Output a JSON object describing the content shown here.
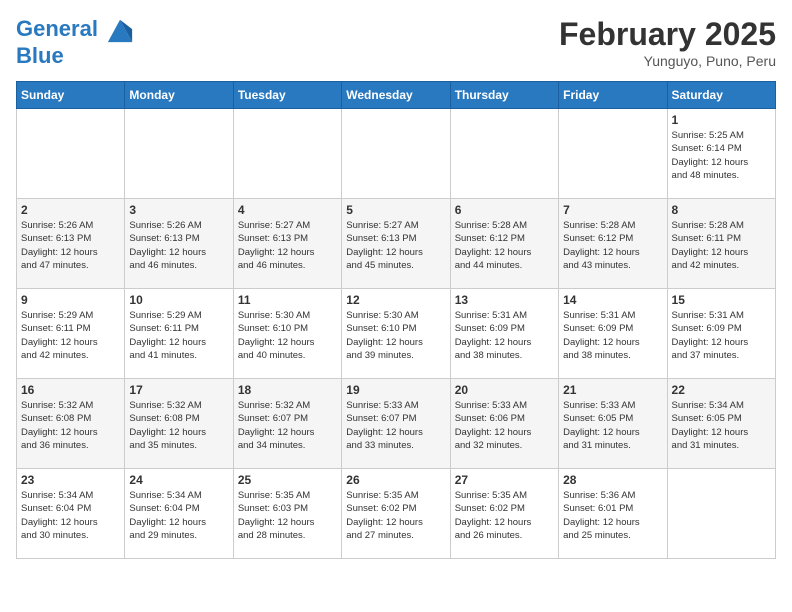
{
  "header": {
    "logo_line1": "General",
    "logo_line2": "Blue",
    "month_title": "February 2025",
    "subtitle": "Yunguyo, Puno, Peru"
  },
  "days_of_week": [
    "Sunday",
    "Monday",
    "Tuesday",
    "Wednesday",
    "Thursday",
    "Friday",
    "Saturday"
  ],
  "weeks": [
    [
      {
        "day": "",
        "info": ""
      },
      {
        "day": "",
        "info": ""
      },
      {
        "day": "",
        "info": ""
      },
      {
        "day": "",
        "info": ""
      },
      {
        "day": "",
        "info": ""
      },
      {
        "day": "",
        "info": ""
      },
      {
        "day": "1",
        "info": "Sunrise: 5:25 AM\nSunset: 6:14 PM\nDaylight: 12 hours\nand 48 minutes."
      }
    ],
    [
      {
        "day": "2",
        "info": "Sunrise: 5:26 AM\nSunset: 6:13 PM\nDaylight: 12 hours\nand 47 minutes."
      },
      {
        "day": "3",
        "info": "Sunrise: 5:26 AM\nSunset: 6:13 PM\nDaylight: 12 hours\nand 46 minutes."
      },
      {
        "day": "4",
        "info": "Sunrise: 5:27 AM\nSunset: 6:13 PM\nDaylight: 12 hours\nand 46 minutes."
      },
      {
        "day": "5",
        "info": "Sunrise: 5:27 AM\nSunset: 6:13 PM\nDaylight: 12 hours\nand 45 minutes."
      },
      {
        "day": "6",
        "info": "Sunrise: 5:28 AM\nSunset: 6:12 PM\nDaylight: 12 hours\nand 44 minutes."
      },
      {
        "day": "7",
        "info": "Sunrise: 5:28 AM\nSunset: 6:12 PM\nDaylight: 12 hours\nand 43 minutes."
      },
      {
        "day": "8",
        "info": "Sunrise: 5:28 AM\nSunset: 6:11 PM\nDaylight: 12 hours\nand 42 minutes."
      }
    ],
    [
      {
        "day": "9",
        "info": "Sunrise: 5:29 AM\nSunset: 6:11 PM\nDaylight: 12 hours\nand 42 minutes."
      },
      {
        "day": "10",
        "info": "Sunrise: 5:29 AM\nSunset: 6:11 PM\nDaylight: 12 hours\nand 41 minutes."
      },
      {
        "day": "11",
        "info": "Sunrise: 5:30 AM\nSunset: 6:10 PM\nDaylight: 12 hours\nand 40 minutes."
      },
      {
        "day": "12",
        "info": "Sunrise: 5:30 AM\nSunset: 6:10 PM\nDaylight: 12 hours\nand 39 minutes."
      },
      {
        "day": "13",
        "info": "Sunrise: 5:31 AM\nSunset: 6:09 PM\nDaylight: 12 hours\nand 38 minutes."
      },
      {
        "day": "14",
        "info": "Sunrise: 5:31 AM\nSunset: 6:09 PM\nDaylight: 12 hours\nand 38 minutes."
      },
      {
        "day": "15",
        "info": "Sunrise: 5:31 AM\nSunset: 6:09 PM\nDaylight: 12 hours\nand 37 minutes."
      }
    ],
    [
      {
        "day": "16",
        "info": "Sunrise: 5:32 AM\nSunset: 6:08 PM\nDaylight: 12 hours\nand 36 minutes."
      },
      {
        "day": "17",
        "info": "Sunrise: 5:32 AM\nSunset: 6:08 PM\nDaylight: 12 hours\nand 35 minutes."
      },
      {
        "day": "18",
        "info": "Sunrise: 5:32 AM\nSunset: 6:07 PM\nDaylight: 12 hours\nand 34 minutes."
      },
      {
        "day": "19",
        "info": "Sunrise: 5:33 AM\nSunset: 6:07 PM\nDaylight: 12 hours\nand 33 minutes."
      },
      {
        "day": "20",
        "info": "Sunrise: 5:33 AM\nSunset: 6:06 PM\nDaylight: 12 hours\nand 32 minutes."
      },
      {
        "day": "21",
        "info": "Sunrise: 5:33 AM\nSunset: 6:05 PM\nDaylight: 12 hours\nand 31 minutes."
      },
      {
        "day": "22",
        "info": "Sunrise: 5:34 AM\nSunset: 6:05 PM\nDaylight: 12 hours\nand 31 minutes."
      }
    ],
    [
      {
        "day": "23",
        "info": "Sunrise: 5:34 AM\nSunset: 6:04 PM\nDaylight: 12 hours\nand 30 minutes."
      },
      {
        "day": "24",
        "info": "Sunrise: 5:34 AM\nSunset: 6:04 PM\nDaylight: 12 hours\nand 29 minutes."
      },
      {
        "day": "25",
        "info": "Sunrise: 5:35 AM\nSunset: 6:03 PM\nDaylight: 12 hours\nand 28 minutes."
      },
      {
        "day": "26",
        "info": "Sunrise: 5:35 AM\nSunset: 6:02 PM\nDaylight: 12 hours\nand 27 minutes."
      },
      {
        "day": "27",
        "info": "Sunrise: 5:35 AM\nSunset: 6:02 PM\nDaylight: 12 hours\nand 26 minutes."
      },
      {
        "day": "28",
        "info": "Sunrise: 5:36 AM\nSunset: 6:01 PM\nDaylight: 12 hours\nand 25 minutes."
      },
      {
        "day": "",
        "info": ""
      }
    ]
  ]
}
